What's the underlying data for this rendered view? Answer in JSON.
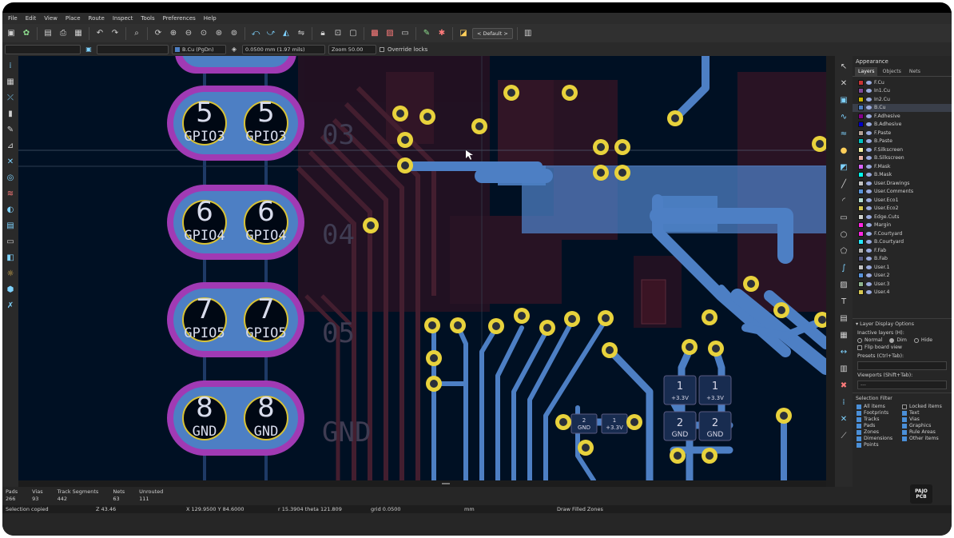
{
  "menu": [
    "File",
    "Edit",
    "View",
    "Place",
    "Route",
    "Inspect",
    "Tools",
    "Preferences",
    "Help"
  ],
  "toolbar": {
    "preset_label": "< Default >",
    "icons": [
      "save-icon",
      "board-setup-icon",
      "page-settings-icon",
      "print-icon",
      "plot-icon",
      "undo-icon",
      "redo-icon",
      "find-icon",
      "refresh-icon",
      "zoom-in-icon",
      "zoom-out-icon",
      "zoom-fit-icon",
      "zoom-objects-icon",
      "zoom-selection-icon",
      "rotate-ccw-icon",
      "rotate-cw-icon",
      "mirror-icon",
      "flip-icon",
      "lock-icon",
      "unlock-icon",
      "group-icon",
      "ungroup-icon",
      "netlist-icon",
      "update-pcb-icon",
      "drc-icon",
      "scripting-icon",
      "layer-pair-icon"
    ]
  },
  "toolbar2": {
    "track_width": "",
    "via_size": "",
    "layer": "B.Cu (PgDn)",
    "grid": "0.0500 mm (1.97 mils)",
    "zoom": "Zoom 50.00",
    "override_locks": "Override locks"
  },
  "board": {
    "pads": [
      {
        "num": "5",
        "label": "GPIO3"
      },
      {
        "num": "6",
        "label": "GPIO4"
      },
      {
        "num": "7",
        "label": "GPIO5"
      },
      {
        "num": "8",
        "label": "GND"
      }
    ],
    "silk_labels": [
      "03",
      "04",
      "05",
      "GND"
    ],
    "components": [
      {
        "num": "1",
        "net": "+3.3V"
      },
      {
        "num": "2",
        "net": "GND"
      }
    ],
    "small_labels": [
      "2",
      "GND",
      "1",
      "+3.3V"
    ]
  },
  "appearance": {
    "title": "Appearance",
    "tabs": [
      "Layers",
      "Objects",
      "Nets"
    ],
    "active_tab": "Layers",
    "layers": [
      {
        "name": "F.Cu",
        "color": "#c83434"
      },
      {
        "name": "In1.Cu",
        "color": "#7f4a9a"
      },
      {
        "name": "In2.Cu",
        "color": "#c8b400"
      },
      {
        "name": "B.Cu",
        "color": "#4d7fc4"
      },
      {
        "name": "F.Adhesive",
        "color": "#84008a"
      },
      {
        "name": "B.Adhesive",
        "color": "#0000c2"
      },
      {
        "name": "F.Paste",
        "color": "#b4a096"
      },
      {
        "name": "B.Paste",
        "color": "#00c2c2"
      },
      {
        "name": "F.Silkscreen",
        "color": "#f2eda1"
      },
      {
        "name": "B.Silkscreen",
        "color": "#e8b2a7"
      },
      {
        "name": "F.Mask",
        "color": "#d864ff"
      },
      {
        "name": "B.Mask",
        "color": "#02ffee"
      },
      {
        "name": "User.Drawings",
        "color": "#c2c2c2"
      },
      {
        "name": "User.Comments",
        "color": "#5994dc"
      },
      {
        "name": "User.Eco1",
        "color": "#b4db d2"
      },
      {
        "name": "User.Eco2",
        "color": "#d8c852"
      },
      {
        "name": "Edge.Cuts",
        "color": "#d0d2cd"
      },
      {
        "name": "Margin",
        "color": "#ff26e2"
      },
      {
        "name": "F.Courtyard",
        "color": "#ff26e2"
      },
      {
        "name": "B.Courtyard",
        "color": "#26e9ff"
      },
      {
        "name": "F.Fab",
        "color": "#afafaf"
      },
      {
        "name": "B.Fab",
        "color": "#585d84"
      },
      {
        "name": "User.1",
        "color": "#c2c2c2"
      },
      {
        "name": "User.2",
        "color": "#5994dc"
      },
      {
        "name": "User.3",
        "color": "#8fb48f"
      },
      {
        "name": "User.4",
        "color": "#d8c852"
      }
    ],
    "selected_layer": "B.Cu",
    "display_options_title": "Layer Display Options",
    "inactive_label": "Inactive layers (H):",
    "inactive_options": [
      "Normal",
      "Dim",
      "Hide"
    ],
    "inactive_selected": "Dim",
    "flip_label": "Flip board view",
    "presets_label": "Presets (Ctrl+Tab):",
    "presets_value": "",
    "viewports_label": "Viewports (Shift+Tab):",
    "viewports_value": "---"
  },
  "selection_filter": {
    "title": "Selection Filter",
    "items": [
      "All items",
      "Locked items",
      "Footprints",
      "Text",
      "Tracks",
      "Vias",
      "Pads",
      "Graphics",
      "Zones",
      "Rule Areas",
      "Dimensions",
      "Other items",
      "Points"
    ]
  },
  "status": {
    "stats": [
      {
        "label": "Pads",
        "value": "266"
      },
      {
        "label": "Vias",
        "value": "93"
      },
      {
        "label": "Track Segments",
        "value": "442"
      },
      {
        "label": "Nets",
        "value": "63"
      },
      {
        "label": "Unrouted",
        "value": "111"
      }
    ],
    "message": "Selection copied",
    "z": "Z 43.46",
    "xy": "X 129.9500  Y 84.6000",
    "dxy": "r 15.3904  theta 121.809",
    "grid": "grid 0.0500",
    "units": "mm",
    "mode": "Draw Filled Zones"
  },
  "logo": {
    "line1": "PAJO",
    "line2": "PCB"
  },
  "colors": {
    "board_bg": "#001023",
    "copper_back": "#4d7fc4",
    "mask_ring": "#a03ab4",
    "via_ring": "#d8c236",
    "front_copper": "#4a1626"
  }
}
